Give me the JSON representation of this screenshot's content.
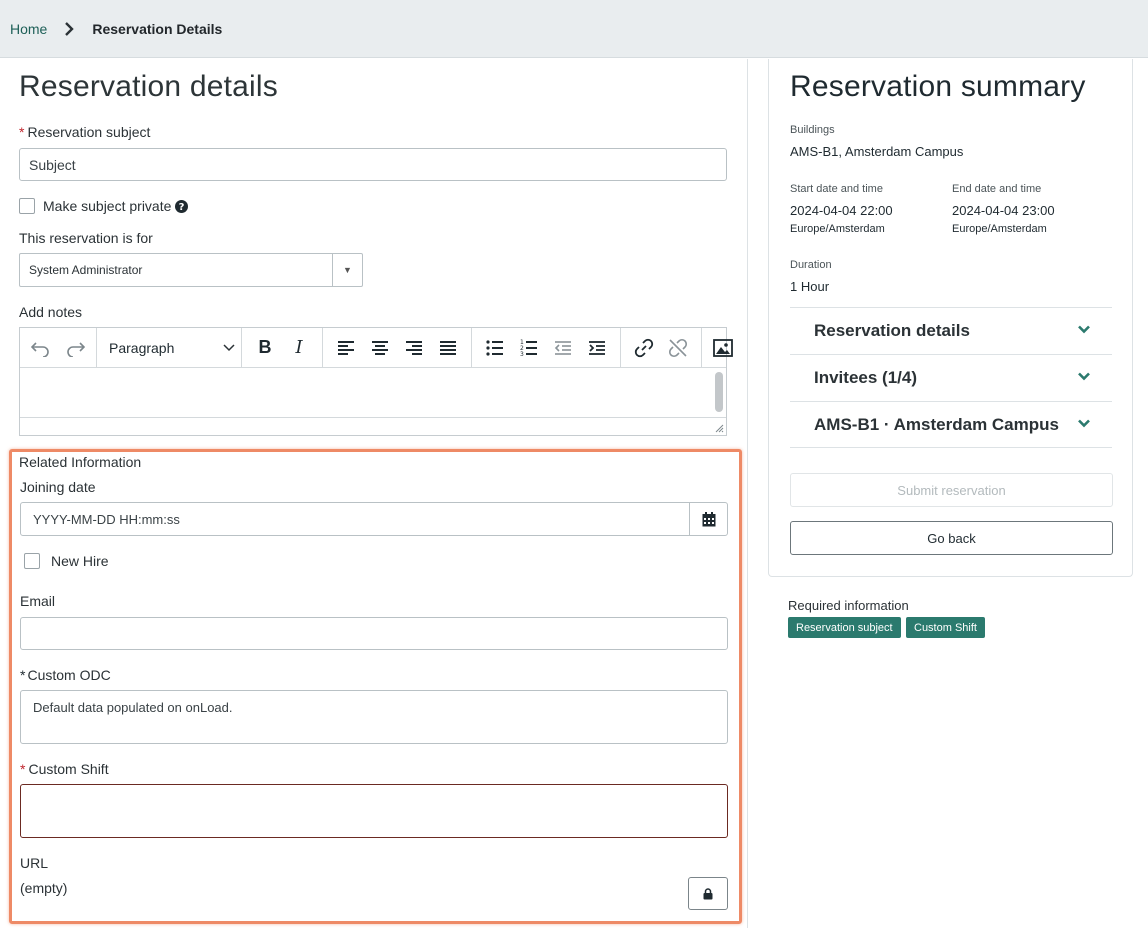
{
  "breadcrumb": {
    "home": "Home",
    "current": "Reservation Details"
  },
  "form": {
    "title": "Reservation details",
    "subject_label": "Reservation subject",
    "subject_value": "Subject",
    "private_label": "Make subject private",
    "for_label": "This reservation is for",
    "for_value": "System Administrator",
    "notes_label": "Add notes",
    "paragraph_label": "Paragraph"
  },
  "related": {
    "section_label": "Related Information",
    "joining_label": "Joining date",
    "joining_placeholder": "YYYY-MM-DD HH:mm:ss",
    "newhire_label": "New Hire",
    "email_label": "Email",
    "odc_label": "Custom ODC",
    "odc_value": "Default data populated on onLoad.",
    "shift_label": "Custom Shift",
    "url_label": "URL",
    "url_value": "(empty)"
  },
  "summary": {
    "title": "Reservation summary",
    "buildings_label": "Buildings",
    "buildings_value": "AMS-B1, Amsterdam Campus",
    "start_label": "Start date and time",
    "start_value": "2024-04-04 22:00",
    "start_tz": "Europe/Amsterdam",
    "end_label": "End date and time",
    "end_value": "2024-04-04 23:00",
    "end_tz": "Europe/Amsterdam",
    "duration_label": "Duration",
    "duration_value": "1 Hour",
    "accordions": [
      "Reservation details",
      "Invitees (1/4)",
      "AMS-B1 · Amsterdam Campus"
    ],
    "submit_label": "Submit reservation",
    "back_label": "Go back"
  },
  "required_info": {
    "label": "Required information",
    "tags": [
      "Reservation subject",
      "Custom Shift"
    ]
  },
  "colors": {
    "accent": "#2b7a6e",
    "highlight_border": "#ee8a66",
    "required": "#c0262d"
  }
}
